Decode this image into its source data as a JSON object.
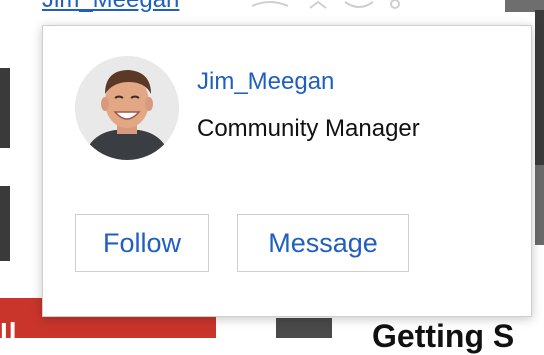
{
  "background": {
    "top_link": "Jim_Meegan",
    "red_banner_text": "Il",
    "heading_fragment": "Getting S"
  },
  "profile_card": {
    "username": "Jim_Meegan",
    "role": "Community Manager",
    "avatar_icon": "user-avatar-photo",
    "actions": {
      "follow_label": "Follow",
      "message_label": "Message"
    }
  },
  "colors": {
    "link": "#1f5fbf",
    "text": "#111111",
    "border": "#cfcfcf",
    "banner_red": "#c9352b"
  }
}
